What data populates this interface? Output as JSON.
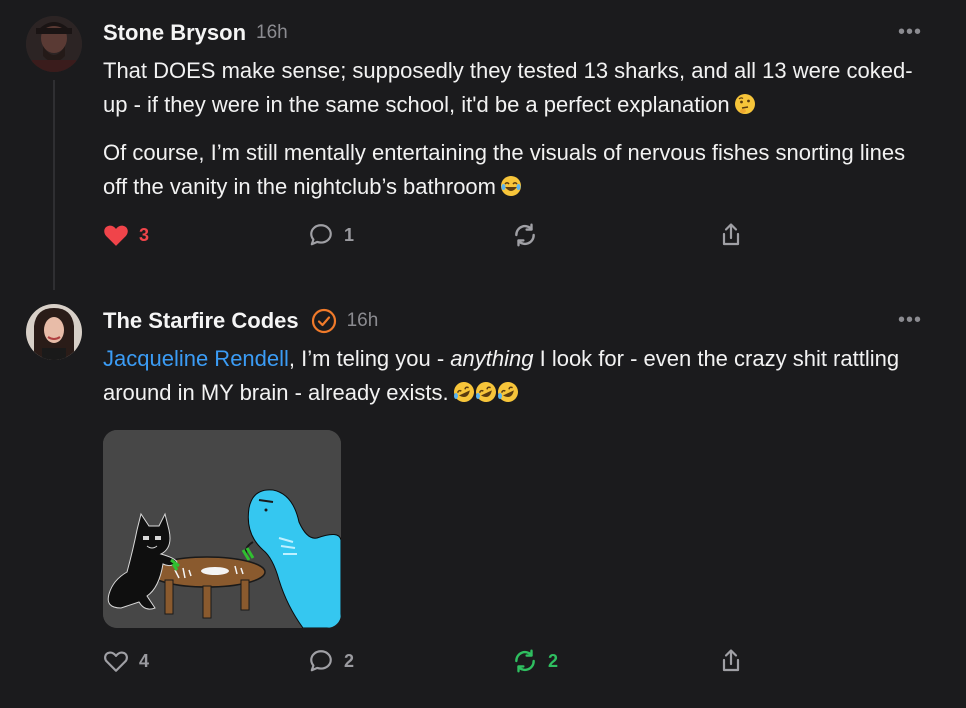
{
  "posts": [
    {
      "author": "Stone Bryson",
      "time": "16h",
      "paragraphs": [
        "That DOES make sense; supposedly they tested 13 sharks, and all 13 were coked-up - if they were in the same school, it'd be a perfect explanation",
        "Of course, I’m still mentally entertaining the visuals of nervous fishes snorting lines off the vanity in the nightclub’s bathroom"
      ],
      "emojis": [
        "thinking-face",
        "tears-of-joy"
      ],
      "actions": {
        "likes": "3",
        "replies": "1",
        "restacks": "",
        "liked": true
      }
    },
    {
      "author": "The Starfire Codes",
      "time": "16h",
      "mention": "Jacqueline Rendell",
      "text_after_mention": ", I’m teling you - ",
      "italic": "anything",
      "text_line_rest": " I look for - even the crazy shit rattling around in MY brain - already exists.",
      "emojis": [
        "rofl",
        "rofl",
        "rofl"
      ],
      "attachment": "drawing of a cat and a shark at a table",
      "actions": {
        "likes": "4",
        "replies": "2",
        "restacks": "2",
        "restacked": true
      }
    }
  ],
  "colors": {
    "background": "#1b1b1d",
    "like_active": "#f0444a",
    "restack_active": "#2fbf60",
    "mention": "#3b9cf5",
    "verified": "#f07a2a",
    "muted": "#8b8b90"
  }
}
